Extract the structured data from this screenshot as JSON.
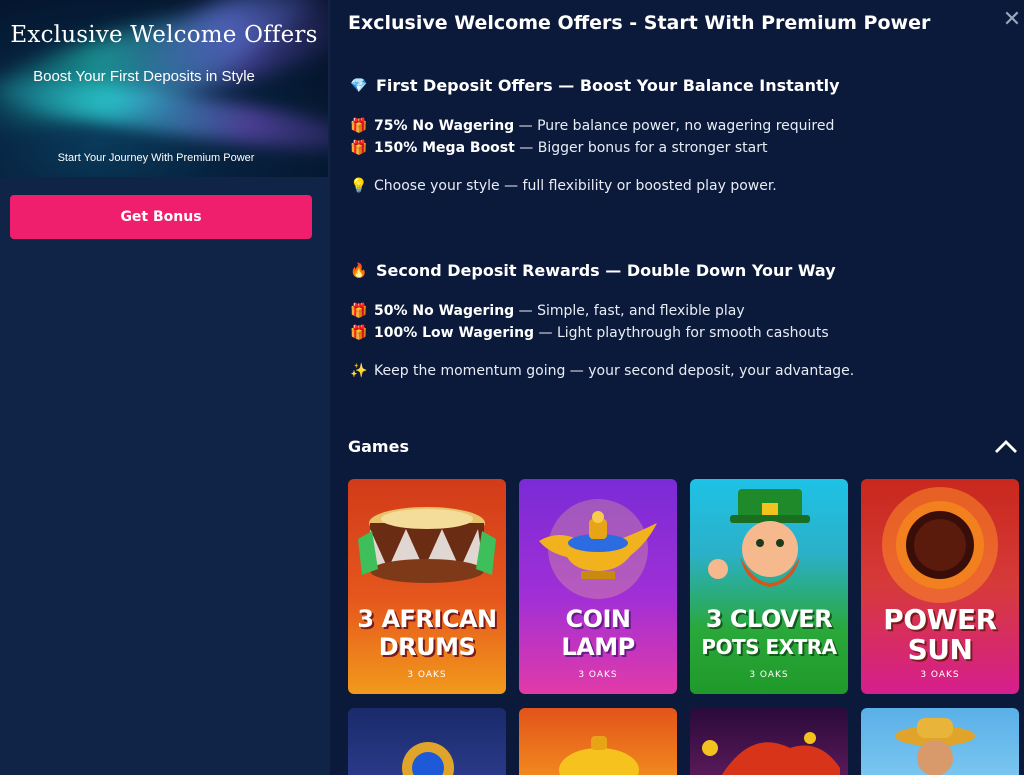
{
  "banner": {
    "title": "Exclusive Welcome Offers",
    "subtitle": "Boost Your First Deposits in Style",
    "footer": "Start Your Journey With Premium Power"
  },
  "cta": {
    "label": "Get Bonus"
  },
  "header": {
    "title": "Exclusive Welcome Offers - Start With Premium Power"
  },
  "first_deposit": {
    "heading": "First Deposit Offers — Boost Your Balance Instantly",
    "heading_icon": "gem-icon",
    "items": [
      {
        "icon": "gift-icon",
        "bold": "75% No Wagering",
        "text": " — Pure balance power, no wagering required"
      },
      {
        "icon": "gift-icon",
        "bold": "150% Mega Boost",
        "text": " — Bigger bonus for a stronger start"
      }
    ],
    "note_icon": "lightbulb-icon",
    "note": "Choose your style — full flexibility or boosted play power."
  },
  "second_deposit": {
    "heading": "Second Deposit Rewards — Double Down Your Way",
    "heading_icon": "fire-icon",
    "items": [
      {
        "icon": "gift-icon",
        "bold": "50% No Wagering",
        "text": " — Simple, fast, and flexible play"
      },
      {
        "icon": "gift-icon",
        "bold": "100% Low Wagering",
        "text": " — Light playthrough for smooth cashouts"
      }
    ],
    "note_icon": "sparkles-icon",
    "note": "Keep the momentum going — your second deposit, your advantage."
  },
  "games": {
    "heading": "Games",
    "tiles": [
      {
        "name_line1": "3 AFRICAN",
        "name_line2": "DRUMS",
        "provider": "3 OAKS"
      },
      {
        "name_line1": "COIN",
        "name_line2": "LAMP",
        "provider": "3 OAKS"
      },
      {
        "name_line1": "3 CLOVER",
        "name_line2": "POTS EXTRA",
        "provider": "3 OAKS"
      },
      {
        "name_line1": "POWER",
        "name_line2": "SUN",
        "provider": "3 OAKS"
      }
    ]
  },
  "colors": {
    "accent": "#ef1f6d",
    "background": "#0b1a3a",
    "panel": "#0f2447"
  }
}
